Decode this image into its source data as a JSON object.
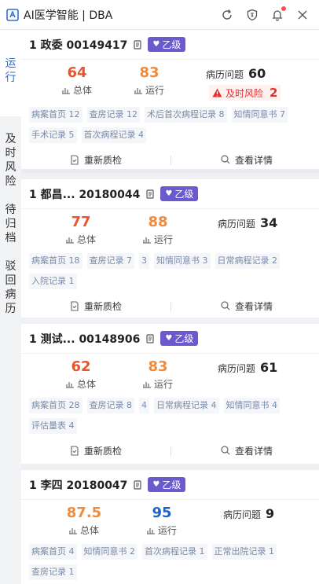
{
  "titlebar": {
    "title": "AI医学智能 | DBA"
  },
  "nav": [
    {
      "label": [
        "运",
        "行"
      ],
      "active": true
    },
    {
      "label": [
        "及",
        "时",
        "风",
        "险"
      ],
      "active": false
    },
    {
      "label": [
        "待",
        "归",
        "档"
      ],
      "active": false
    },
    {
      "label": [
        "驳",
        "回",
        "病",
        "历"
      ],
      "active": false
    }
  ],
  "labels": {
    "total": "总体",
    "run": "运行",
    "problem": "病历问题",
    "risk": "及时风险",
    "recheck": "重新质检",
    "detail": "查看详情",
    "grade": "乙级"
  },
  "cards": [
    {
      "title": "1 政委 00149417",
      "total": "64",
      "run": "83",
      "problem": "60",
      "risk": "2",
      "tags": [
        "病案首页 12",
        "查房记录 12",
        "术后首次病程记录 8",
        "知情同意书 7",
        "手术记录 5",
        "首次病程记录 4"
      ]
    },
    {
      "title": "1 都昌... 20180044",
      "total": "77",
      "run": "88",
      "problem": "34",
      "tags": [
        "病案首页 18",
        "查房记录 7",
        "3",
        "知情同意书 3",
        "日常病程记录 2",
        "入院记录 1"
      ]
    },
    {
      "title": "1 测试... 00148906",
      "total": "62",
      "run": "83",
      "problem": "61",
      "tags": [
        "病案首页 28",
        "查房记录 8",
        "4",
        "日常病程记录 4",
        "知情同意书 4",
        "评估量表 4"
      ]
    },
    {
      "title": "1 李四 20180047",
      "total": "87.5",
      "run": "95",
      "problem": "9",
      "tags": [
        "病案首页 4",
        "知情同意书 2",
        "首次病程记录 1",
        "正常出院记录 1",
        "查房记录 1"
      ]
    }
  ]
}
